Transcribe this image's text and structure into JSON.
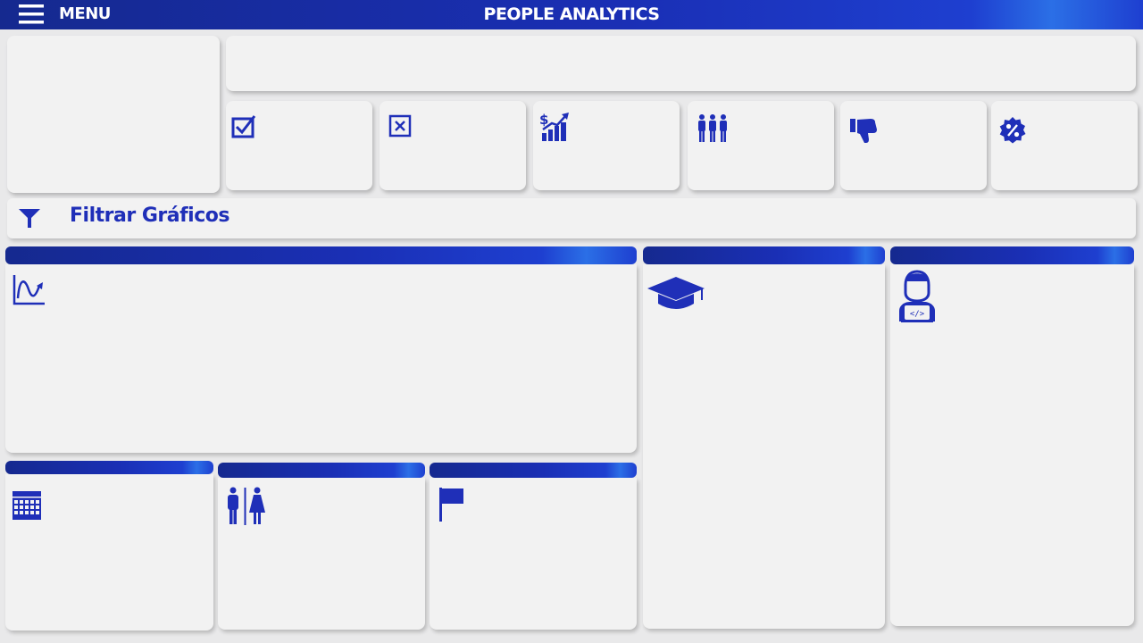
{
  "header": {
    "menu_label": "MENU",
    "title": "PEOPLE ANALYTICS",
    "menu_icon": "hamburger-icon"
  },
  "kpi_cards": [
    {
      "icon": "checkbox-checked-icon"
    },
    {
      "icon": "checkbox-cross-icon"
    },
    {
      "icon": "salary-growth-chart-icon"
    },
    {
      "icon": "people-group-icon"
    },
    {
      "icon": "thumbs-down-icon"
    },
    {
      "icon": "percent-badge-icon"
    }
  ],
  "filter": {
    "label": "Filtrar Gráficos",
    "icon": "filter-funnel-icon"
  },
  "charts": [
    {
      "id": "trend",
      "icon": "line-trend-icon"
    },
    {
      "id": "education",
      "icon": "graduation-cap-icon"
    },
    {
      "id": "role",
      "icon": "developer-icon"
    },
    {
      "id": "calendar",
      "icon": "calendar-icon"
    },
    {
      "id": "gender",
      "icon": "gender-icon"
    },
    {
      "id": "location",
      "icon": "flag-icon"
    }
  ],
  "colors": {
    "accent": "#1f2fb8",
    "header_dark": "#15298f",
    "panel": "#f2f2f2",
    "background": "#e9e9ea"
  }
}
